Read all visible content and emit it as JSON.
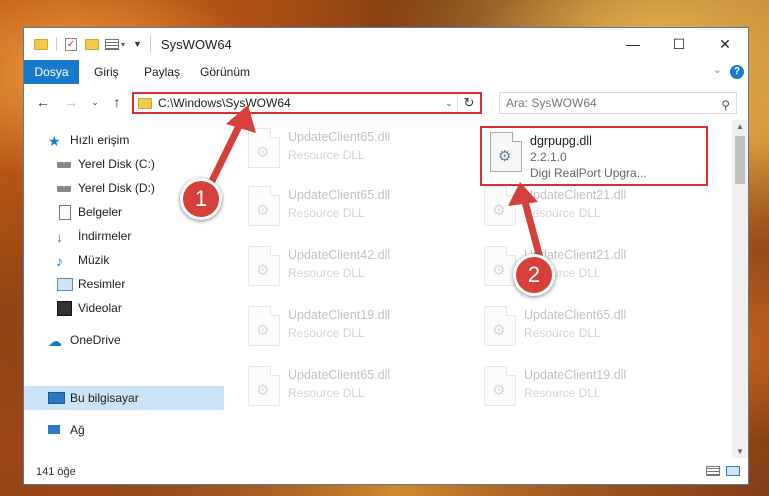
{
  "window": {
    "title": "SysWOW64"
  },
  "ribbon": {
    "tabs": [
      "Dosya",
      "Giriş",
      "Paylaş",
      "Görünüm"
    ]
  },
  "address": {
    "path": "C:\\Windows\\SysWOW64",
    "search_placeholder": "Ara: SysWOW64"
  },
  "sidebar": {
    "items": [
      {
        "label": "Hızlı erişim",
        "icon": "star-icon"
      },
      {
        "label": "Yerel Disk (C:)",
        "icon": "drive-icon",
        "pinned": true
      },
      {
        "label": "Yerel Disk (D:)",
        "icon": "drive-icon",
        "pinned": true
      },
      {
        "label": "Belgeler",
        "icon": "document-icon",
        "pinned": true
      },
      {
        "label": "İndirmeler",
        "icon": "download-icon",
        "pinned": true
      },
      {
        "label": "Müzik",
        "icon": "music-icon",
        "pinned": true
      },
      {
        "label": "Resimler",
        "icon": "pictures-icon",
        "pinned": true
      },
      {
        "label": "Videolar",
        "icon": "video-icon",
        "pinned": true
      },
      {
        "label": "OneDrive",
        "icon": "cloud-icon"
      },
      {
        "label": "Bu bilgisayar",
        "icon": "computer-icon",
        "selected": true
      },
      {
        "label": "Ağ",
        "icon": "network-icon"
      }
    ]
  },
  "files": {
    "highlighted": {
      "name": "dgrpupg.dll",
      "version": "2.2.1.0",
      "description": "Digi RealPort Upgra..."
    },
    "left_column": [
      {
        "name": "UpdateClient65.dll",
        "type": "Resource DLL"
      },
      {
        "name": "UpdateClient65.dll",
        "type": "Resource DLL"
      },
      {
        "name": "UpdateClient42.dll",
        "type": "Resource DLL"
      },
      {
        "name": "UpdateClient19.dll",
        "type": "Resource DLL"
      },
      {
        "name": "UpdateClient65.dll",
        "type": "Resource DLL"
      }
    ],
    "right_column": [
      {
        "name": "UpdateClient21.dll",
        "type": "Resource DLL"
      },
      {
        "name": "UpdateClient21.dll",
        "type": "Resource DLL"
      },
      {
        "name": "UpdateClient65.dll",
        "type": "Resource DLL"
      },
      {
        "name": "UpdateClient19.dll",
        "type": "Resource DLL"
      }
    ]
  },
  "status": {
    "count": "141 öğe"
  },
  "callouts": {
    "one": "1",
    "two": "2"
  },
  "colors": {
    "accent": "#1979ca",
    "highlight": "#d73030",
    "selected": "#cce4f7"
  }
}
